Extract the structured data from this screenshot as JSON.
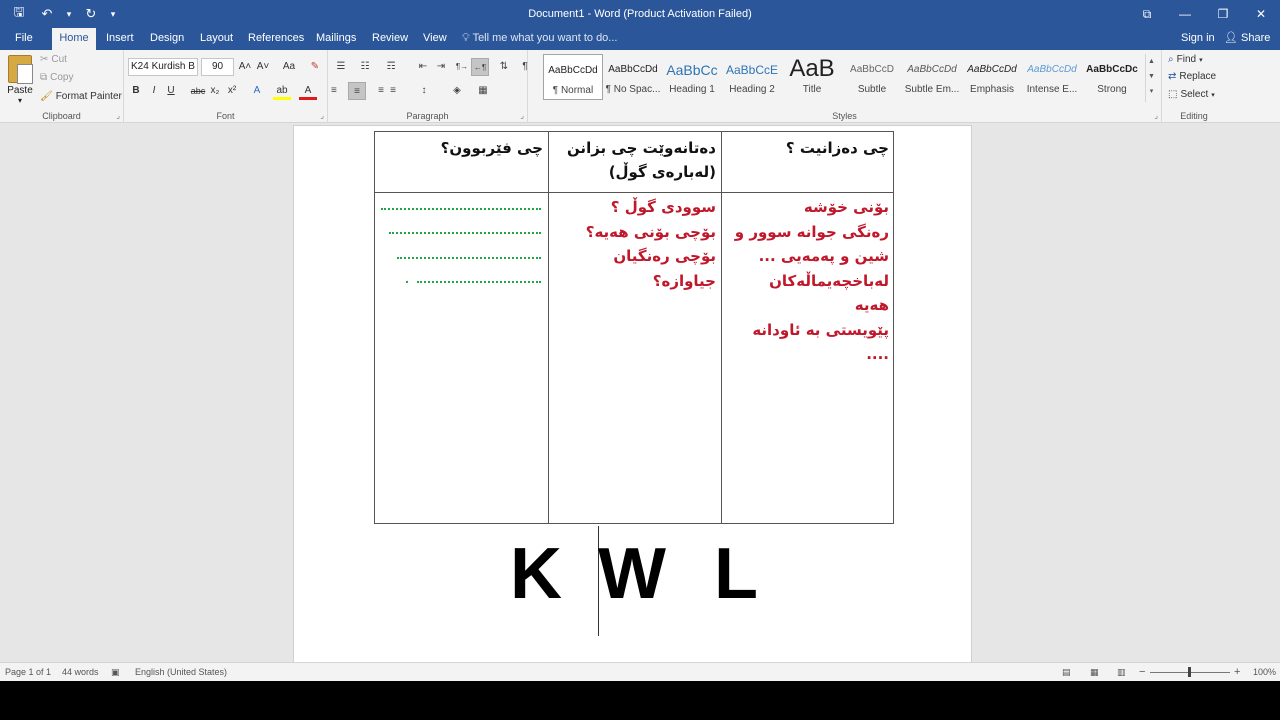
{
  "titlebar": {
    "title": "Document1 - Word (Product Activation Failed)",
    "qat": {
      "save": "🖫",
      "undo": "↶",
      "undo_drop": "▾",
      "redo": "↻",
      "customize": "▾"
    },
    "window": {
      "ribbon_options": "⧉",
      "minimize": "—",
      "restore": "❐",
      "close": "✕"
    }
  },
  "tabs": [
    "File",
    "Home",
    "Insert",
    "Design",
    "Layout",
    "References",
    "Mailings",
    "Review",
    "View"
  ],
  "tellme": "Tell me what you want to do...",
  "signin": "Sign in",
  "share": "Share",
  "clipboard": {
    "paste": "Paste",
    "cut": "Cut",
    "copy": "Copy",
    "format_painter": "Format Painter",
    "label": "Clipboard"
  },
  "font": {
    "name": "K24 Kurdish B",
    "size": "90",
    "label": "Font",
    "grow": "A˄",
    "shrink": "A˅",
    "change_case": "Aa",
    "clear": "✎",
    "bold": "B",
    "italic": "I",
    "underline": "U",
    "strike": "abc",
    "subscript": "x₂",
    "superscript": "x²",
    "text_effects": "A",
    "highlight": "ab",
    "font_color": "A"
  },
  "paragraph": {
    "label": "Paragraph",
    "bullets": "☰",
    "numbering": "☷",
    "multilevel": "☶",
    "decrease_indent": "⇤",
    "increase_indent": "⇥",
    "ltr": "¶→",
    "rtl": "←¶",
    "sort": "⇅",
    "show_marks": "¶",
    "align_left": "≡",
    "align_center": "≡",
    "align_right": "≡",
    "justify": "≡",
    "line_spacing": "↕",
    "shading": "◈",
    "borders": "▦"
  },
  "styles": {
    "label": "Styles",
    "items": [
      {
        "sample": "AaBbCcDd",
        "name": "¶ Normal"
      },
      {
        "sample": "AaBbCcDd",
        "name": "¶ No Spac..."
      },
      {
        "sample": "AaBbCc",
        "name": "Heading 1"
      },
      {
        "sample": "AaBbCcE",
        "name": "Heading 2"
      },
      {
        "sample": "AaB",
        "name": "Title"
      },
      {
        "sample": "AaBbCcD",
        "name": "Subtle"
      },
      {
        "sample": "AaBbCcDd",
        "name": "Subtle Em..."
      },
      {
        "sample": "AaBbCcDd",
        "name": "Emphasis"
      },
      {
        "sample": "AaBbCcDd",
        "name": "Intense E..."
      },
      {
        "sample": "AaBbCcDc",
        "name": "Strong"
      }
    ],
    "scroll": {
      "up": "▲",
      "down": "▼",
      "more": "▾"
    }
  },
  "editing": {
    "label": "Editing",
    "find": "Find",
    "replace": "Replace",
    "select": "Select"
  },
  "kwl": {
    "header_k": "چی دەزانیت ؟",
    "header_w": "دەتانەوێت چی بزانن (لەبارەی گوڵ)",
    "header_l": "چی فێربوون؟",
    "k_lines": [
      "بۆنی خۆشە",
      "رەنگی جوانە سوور و",
      "شین و پەمەیی ...",
      "لەباخچەیماڵەکان",
      "هەیە",
      "پێویستی بە ئاودانە",
      "...."
    ],
    "w_lines": [
      "سوودی گوڵ ؟",
      "بۆچی بۆنی هەیە؟",
      "بۆچی رەنگیان",
      "جیاوازە؟"
    ],
    "stray_dot": ".",
    "letters": {
      "k": "K",
      "w": "W",
      "l": "L"
    }
  },
  "status": {
    "page": "Page 1 of 1",
    "words": "44 words",
    "language": "English (United States)",
    "zoom": "100%",
    "zoom_minus": "−",
    "zoom_plus": "+"
  },
  "colors": {
    "accent": "#2b579a",
    "red_text": "#c0172a",
    "green_dots": "#21a845"
  }
}
